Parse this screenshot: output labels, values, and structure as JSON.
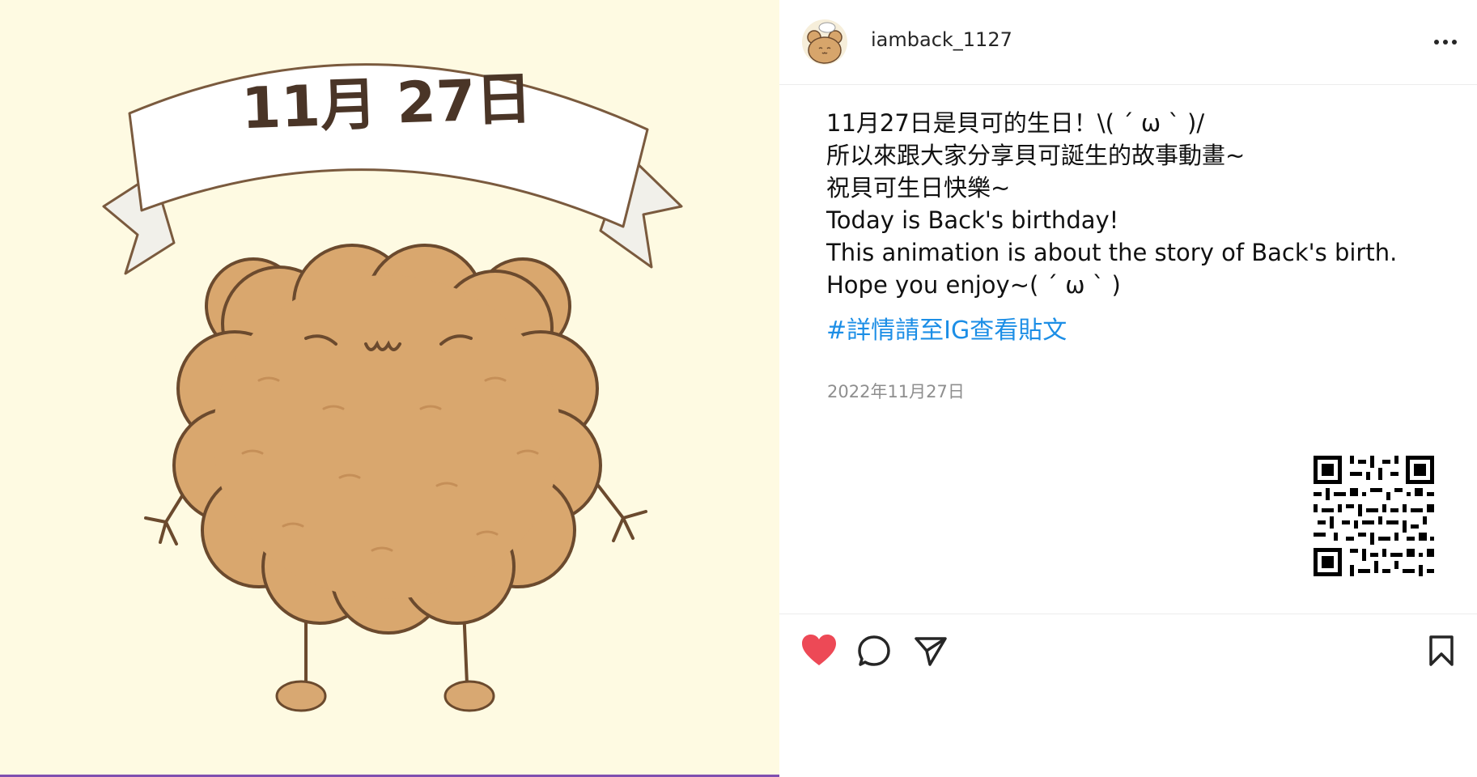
{
  "post": {
    "banner_text": "11月 27日"
  },
  "header": {
    "username": "iamback_1127",
    "avatar_icon": "bear-avatar-icon",
    "more_icon": "more-options-icon"
  },
  "caption": {
    "lines": [
      "11月27日是貝可的生日！\\( ´ ω ` )/",
      "所以來跟大家分享貝可誕生的故事動畫~",
      "祝貝可生日快樂~",
      "Today is Back's birthday!",
      "This animation is about the story of Back's birth.",
      "Hope you enjoy~( ´ ω ` )"
    ],
    "hashtag": "#詳情請至IG查看貼文",
    "date": "2022年11月27日"
  },
  "actions": {
    "like_icon": "heart-filled-icon",
    "comment_icon": "comment-icon",
    "share_icon": "share-icon",
    "save_icon": "bookmark-icon"
  },
  "colors": {
    "link": "#1c8ee6",
    "like": "#ed4956",
    "image_background": "#fefae2",
    "bear_body": "#d9a76e"
  }
}
